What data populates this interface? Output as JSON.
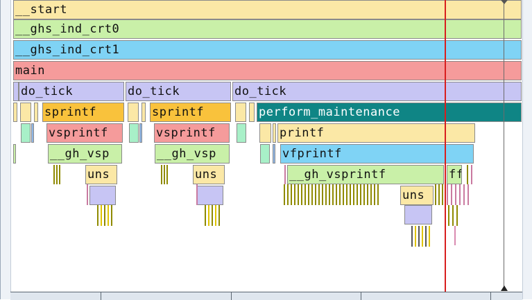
{
  "colors": {
    "yellow": "#fbe8a6",
    "green": "#c9f0a8",
    "blue": "#7fd3f5",
    "red": "#f59b9b",
    "lavender": "#c7c5f4",
    "orange": "#f9c23c",
    "teal": "#0f8585",
    "cursor": "#d81e1e"
  },
  "frames": {
    "start": "__start",
    "crt0": "__ghs_ind_crt0",
    "crt1": "__ghs_ind_crt1",
    "main": "main",
    "do_tick_1": "do_tick",
    "do_tick_2": "do_tick",
    "do_tick_3": "do_tick",
    "sprintf_1": "sprintf",
    "sprintf_2": "sprintf",
    "perform_maintenance": "perform_maintenance",
    "vsprintf_1": "vsprintf",
    "vsprintf_2": "vsprintf",
    "printf": "printf",
    "gh_vsp_1": "__gh_vsp",
    "gh_vsp_2": "__gh_vsp",
    "vfprintf": "vfprintf",
    "uns_1": "uns",
    "uns_2": "uns",
    "gh_vsprintf": "__gh_vsprintf",
    "ff": "ff",
    "uns_3": "uns"
  }
}
